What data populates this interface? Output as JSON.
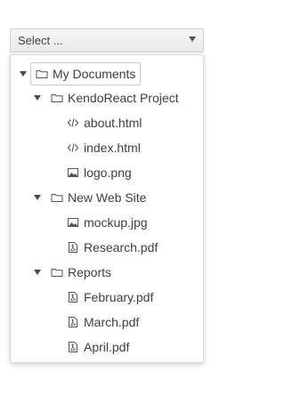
{
  "select": {
    "placeholder": "Select ...",
    "arrow_icon": "caret-down-icon"
  },
  "tree": {
    "root": {
      "label": "My Documents",
      "icon": "folder-icon",
      "expanded": true
    },
    "folders": [
      {
        "label": "KendoReact Project",
        "icon": "folder-icon",
        "expanded": true,
        "files": [
          {
            "label": "about.html",
            "icon": "code-icon"
          },
          {
            "label": "index.html",
            "icon": "code-icon"
          },
          {
            "label": "logo.png",
            "icon": "image-icon"
          }
        ]
      },
      {
        "label": "New Web Site",
        "icon": "folder-icon",
        "expanded": true,
        "files": [
          {
            "label": "mockup.jpg",
            "icon": "image-icon"
          },
          {
            "label": "Research.pdf",
            "icon": "pdf-icon"
          }
        ]
      },
      {
        "label": "Reports",
        "icon": "folder-icon",
        "expanded": true,
        "files": [
          {
            "label": "February.pdf",
            "icon": "pdf-icon"
          },
          {
            "label": "March.pdf",
            "icon": "pdf-icon"
          },
          {
            "label": "April.pdf",
            "icon": "pdf-icon"
          }
        ]
      }
    ]
  },
  "colors": {
    "text": "#3f3f3f",
    "border": "#cfcfcf"
  }
}
